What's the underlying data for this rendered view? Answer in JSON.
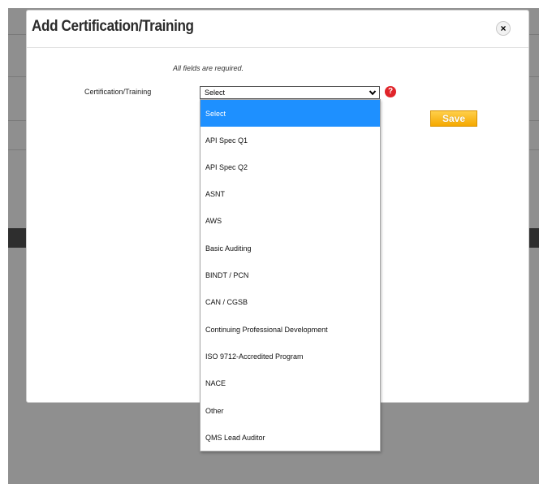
{
  "modal": {
    "title": "Add Certification/Training",
    "close_label": "×",
    "required_note": "All fields are required.",
    "field_label": "Certification/Training",
    "select_value": "Select",
    "help_icon_glyph": "?",
    "save_label": "Save"
  },
  "dropdown": {
    "options": [
      "Select",
      "API Spec Q1",
      "API Spec Q2",
      "ASNT",
      "AWS",
      "Basic Auditing",
      "BINDT / PCN",
      "CAN / CGSB",
      "Continuing Professional Development",
      "ISO 9712-Accredited Program",
      "NACE",
      "Other",
      "QMS Lead Auditor"
    ],
    "selected_index": 0
  },
  "colors": {
    "selected_highlight": "#1e90ff",
    "save_button": "#f5a800",
    "help_icon": "#e0242a",
    "backdrop": "#8f8f8f"
  },
  "icons": {
    "close": "close-icon",
    "dropdown": "chevron-down-icon",
    "help": "help-icon"
  }
}
